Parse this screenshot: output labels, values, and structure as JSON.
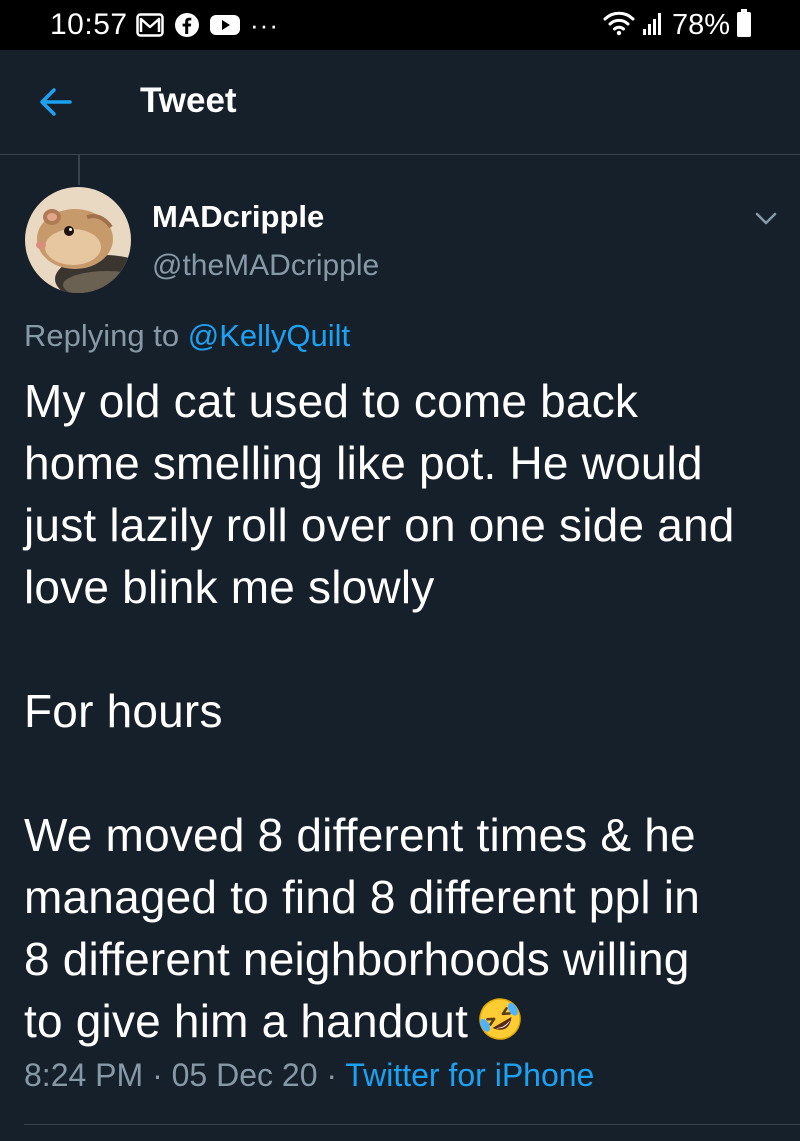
{
  "status_bar": {
    "time": "10:57",
    "left_icons": [
      "gmail-icon",
      "facebook-icon",
      "youtube-icon"
    ],
    "more_dots": "···",
    "battery_percent": "78%"
  },
  "header": {
    "title": "Tweet",
    "back_icon": "arrow-left-icon"
  },
  "tweet": {
    "display_name": "MADcripple",
    "handle": "@theMADcripple",
    "replying_prefix": "Replying to",
    "replying_to": "@KellyQuilt",
    "paragraph_1": "My old cat used to come back\nhome smelling like pot. He would\njust lazily roll over on one side and\nlove blink me slowly",
    "paragraph_2": "For hours",
    "paragraph_3": "We moved 8 different times & he\nmanaged to find 8 different ppl in\n8 different neighborhoods willing\nto give him a handout",
    "emoji": "rolling-on-floor-laughing-emoji",
    "time": "8:24 PM",
    "date": "05 Dec 20",
    "separator": " · ",
    "source": "Twitter for iPhone"
  },
  "colors": {
    "background": "#15202b",
    "status_bar": "#000000",
    "accent": "#1da1f2",
    "secondary_text": "#8899a6",
    "divider": "#38444d"
  }
}
